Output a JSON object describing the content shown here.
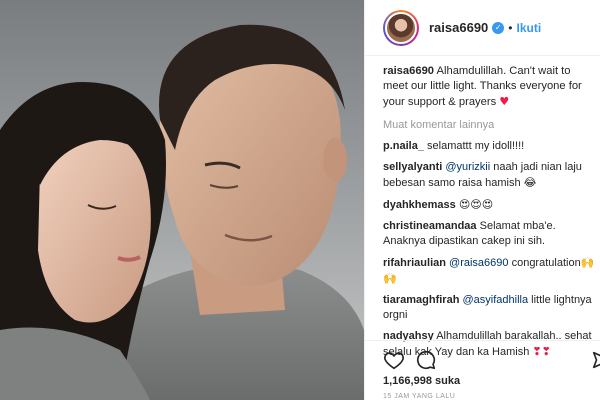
{
  "post": {
    "username": "raisa6690",
    "follow_label": "Ikuti",
    "separator": "•"
  },
  "caption": {
    "username": "raisa6690",
    "text": "Alhamdulillah. Can't wait to meet our little light. Thanks everyone for your support & prayers",
    "emoji": "♥"
  },
  "load_more_label": "Muat komentar lainnya",
  "comments": [
    {
      "username": "p.naila_",
      "mention": "",
      "text": "selamattt my idoll!!!!",
      "emoji": ""
    },
    {
      "username": "sellyalyanti",
      "mention": "@yurizkii",
      "text": "naah jadi nian laju bebesan samo raisa hamish",
      "emoji": "😂"
    },
    {
      "username": "dyahkhemass",
      "mention": "",
      "text": "",
      "emoji": "😍😍😍"
    },
    {
      "username": "christineamandaa",
      "mention": "",
      "text": "Selamat mba'e. Anaknya dipastikan cakep ini sih.",
      "emoji": ""
    },
    {
      "username": "rifahriaulian",
      "mention": "@raisa6690",
      "text": "congratulation",
      "emoji": "🙌🙌"
    },
    {
      "username": "tiaramaghfirah",
      "mention": "@asyifadhilla",
      "text": "little lightnya orgni",
      "emoji": ""
    },
    {
      "username": "nadyahsy",
      "mention": "",
      "text": "Alhamdulillah barakallah.. sehat selalu kak Yay dan ka Hamish",
      "emoji": "❣❣"
    }
  ],
  "likes_label": "1,166,998 suka",
  "timestamp": "15 JAM YANG LALU",
  "icons": [
    "heart-outline-icon",
    "comment-bubble-icon",
    "share-icon"
  ],
  "colors": {
    "accent": "#3897f0",
    "heart": "#ed1b45",
    "muted": "#999999"
  }
}
